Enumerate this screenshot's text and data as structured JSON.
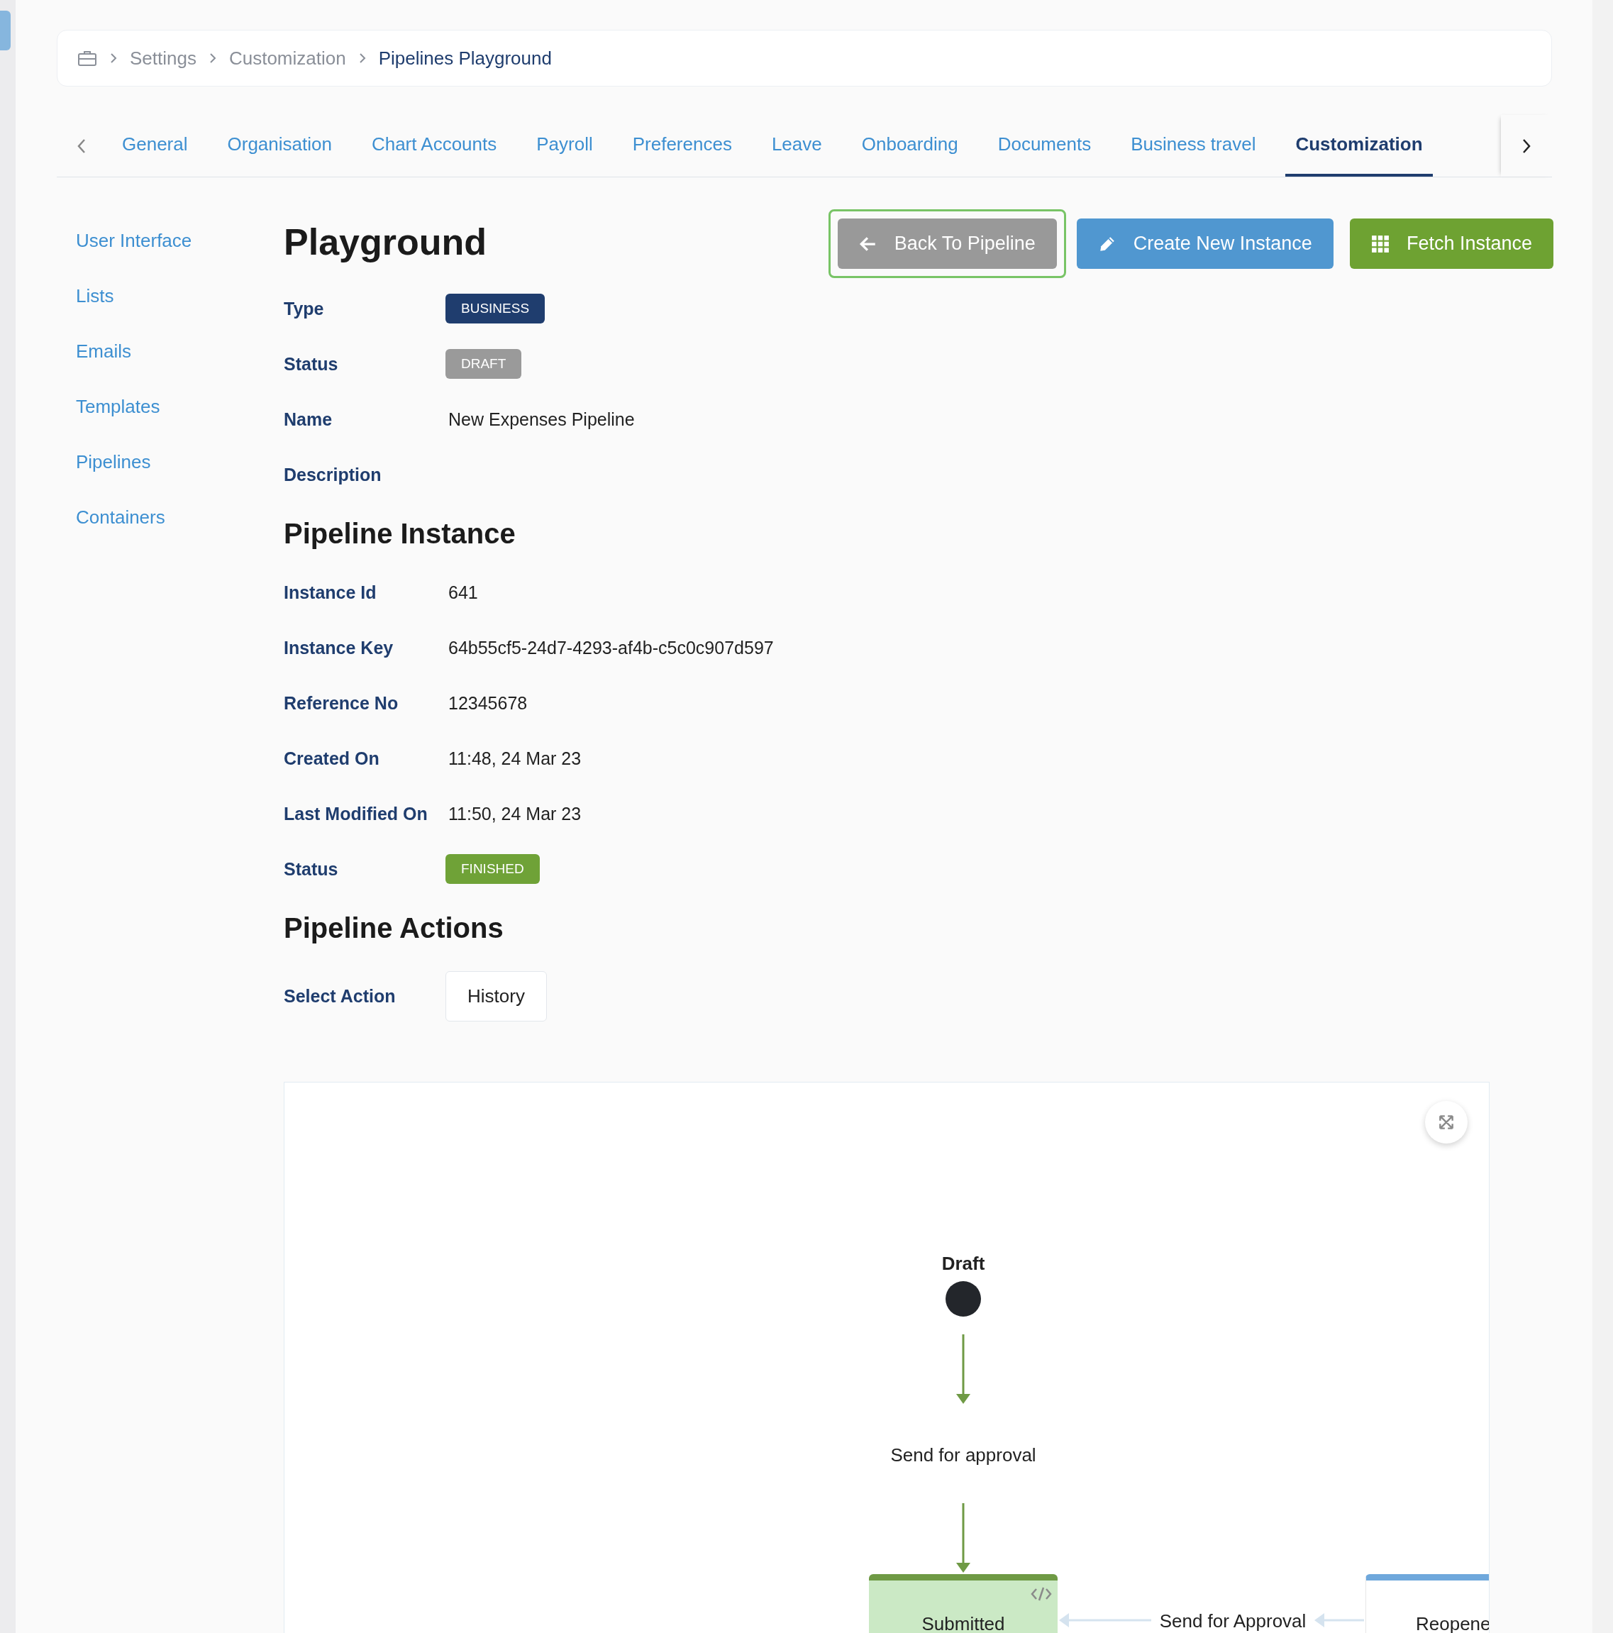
{
  "breadcrumb": [
    {
      "label": "Settings",
      "current": false
    },
    {
      "label": "Customization",
      "current": false
    },
    {
      "label": "Pipelines Playground",
      "current": true
    }
  ],
  "tabs": [
    {
      "label": "General",
      "selected": false
    },
    {
      "label": "Organisation",
      "selected": false
    },
    {
      "label": "Chart Accounts",
      "selected": false
    },
    {
      "label": "Payroll",
      "selected": false
    },
    {
      "label": "Preferences",
      "selected": false
    },
    {
      "label": "Leave",
      "selected": false
    },
    {
      "label": "Onboarding",
      "selected": false
    },
    {
      "label": "Documents",
      "selected": false
    },
    {
      "label": "Business travel",
      "selected": false
    },
    {
      "label": "Customization",
      "selected": true
    }
  ],
  "sidebar": {
    "items": [
      "User Interface",
      "Lists",
      "Emails",
      "Templates",
      "Pipelines",
      "Containers"
    ]
  },
  "title": "Playground",
  "buttons": [
    {
      "label": "Back To Pipeline",
      "kind": "back",
      "focused": true
    },
    {
      "label": "Create New Instance",
      "kind": "create",
      "focused": false
    },
    {
      "label": "Fetch Instance",
      "kind": "fetch",
      "focused": false
    }
  ],
  "details": [
    {
      "label": "Type",
      "value": "BUSINESS",
      "kind": "badge",
      "color": "#1f3d6e"
    },
    {
      "label": "Status",
      "value": "DRAFT",
      "kind": "badge",
      "color": "#9a9a9a"
    },
    {
      "label": "Name",
      "value": "New Expenses Pipeline",
      "kind": "text"
    },
    {
      "label": "Description",
      "kind": "text"
    }
  ],
  "instance": {
    "title": "Pipeline Instance",
    "fields": [
      {
        "label": "Instance Id",
        "value": "641",
        "kind": "text"
      },
      {
        "label": "Instance Key",
        "value": "64b55cf5-24d7-4293-af4b-c5c0c907d597",
        "kind": "text"
      },
      {
        "label": "Reference No",
        "value": "12345678",
        "kind": "text"
      },
      {
        "label": "Created On",
        "value": "11:48, 24 Mar 23",
        "kind": "text"
      },
      {
        "label": "Last Modified On",
        "value": "11:50, 24 Mar 23",
        "kind": "text"
      },
      {
        "label": "Status",
        "value": "FINISHED",
        "kind": "badge",
        "color": "#6fa237"
      }
    ]
  },
  "actions": {
    "title": "Pipeline Actions",
    "label": "Select Action",
    "value": "History"
  },
  "diagram": {
    "start": "Draft",
    "transition": "Send for approval",
    "nodes": [
      {
        "label": "Submitted",
        "color": "#6f9a45"
      },
      {
        "label": "Reopene",
        "color": "#6fa8dc"
      }
    ],
    "edge_label": "Send for Approval"
  }
}
